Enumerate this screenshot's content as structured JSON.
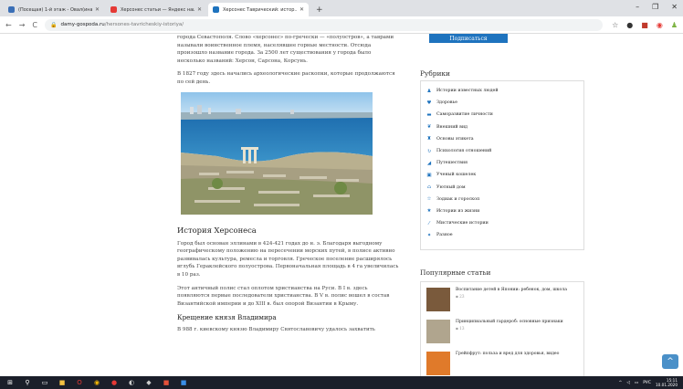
{
  "browser": {
    "tabs": [
      {
        "title": "(Посещая) 1-й этаж - Овал(ина...",
        "active": false,
        "color": "#3b6fb6"
      },
      {
        "title": "Херсонес статьи — Яндекс нашло...",
        "active": false,
        "color": "#e53935"
      },
      {
        "title": "Херсонес Таврический: истор...",
        "active": true,
        "color": "#1e73be"
      }
    ],
    "new_tab": "+",
    "url_host": "damy-gospoda.ru",
    "url_path": "/hersones-tavricheskiy-istoriya/",
    "window_controls": [
      "–",
      "❐",
      "✕"
    ]
  },
  "article": {
    "para0": "города Севастополя. Слово «херсонес» по-гречески — «полуостров», а таврами называли воинственное племя, населявшее горные местности. Отсюда произошло название города. За 2500 лет существования у города было несколько названий: Херсон, Сарсона, Корсунь.",
    "para1": "В 1827 году здесь начались археологические раскопки, которые продолжаются по сей день.",
    "h_history": "История Херсонеса",
    "para2": "Город был основан эллинами в 424-421 годах до н. э. Благодаря выгодному географическому положению на пересечении морских путей, в полисе активно развивалась культура, ремесла и торговля. Греческое поселение расширялось вглубь Гераклейского полуострова. Первоначальная площадь в 4 га увеличилась в 10 раз.",
    "para3": "Этот античный полис стал оплотом христианства на Руси. В I в. здесь появляются первые последователи христианства. В V в. полис вошел в состав Византийской империи и до XIII в. был опорой Византии в Крыму.",
    "h_baptism": "Крещение князя Владимира",
    "para4": "В 988 г. киевскому князю Владимиру Святославовичу удалось захватить"
  },
  "sidebar": {
    "subscribe_label": "Подписаться",
    "rubrics_title": "Рубрики",
    "rubrics": [
      {
        "label": "Истории известных людей",
        "icon": "person-icon",
        "glyph": "♟"
      },
      {
        "label": "Здоровье",
        "icon": "heart-icon",
        "glyph": "♥"
      },
      {
        "label": "Саморазвитие личности",
        "icon": "book-icon",
        "glyph": "▬"
      },
      {
        "label": "Внешний вид",
        "icon": "leaf-icon",
        "glyph": "❦"
      },
      {
        "label": "Основы этикета",
        "icon": "couple-icon",
        "glyph": "♜"
      },
      {
        "label": "Психология отношений",
        "icon": "refresh-icon",
        "glyph": "↻"
      },
      {
        "label": "Путешествия",
        "icon": "plane-icon",
        "glyph": "◢"
      },
      {
        "label": "Ученый кошелек",
        "icon": "wallet-icon",
        "glyph": "▣"
      },
      {
        "label": "Уютный дом",
        "icon": "home-icon",
        "glyph": "⌂"
      },
      {
        "label": "Зодиак и гороскоп",
        "icon": "star-outline-icon",
        "glyph": "☆"
      },
      {
        "label": "Истории из жизни",
        "icon": "star-icon",
        "glyph": "★"
      },
      {
        "label": "Мистические истории",
        "icon": "wand-icon",
        "glyph": "⁄"
      },
      {
        "label": "Разное",
        "icon": "pin-icon",
        "glyph": "✦"
      }
    ],
    "popular_title": "Популярные статьи",
    "popular": [
      {
        "title": "Воспитание детей в Японии: ребенок, дом, школа",
        "views": "23",
        "thumb": "#7a5a3c"
      },
      {
        "title": "Принципиальный гардероб: основные признаки",
        "views": "13",
        "thumb": "#b0a58e"
      },
      {
        "title": "Грейпфрут: польза и вред для здоровья, видео",
        "views": "",
        "thumb": "#e07a2a"
      }
    ]
  },
  "scroll_top": "^",
  "taskbar": {
    "lang": "РУС",
    "time": "15:11",
    "date": "10.01.2020"
  }
}
